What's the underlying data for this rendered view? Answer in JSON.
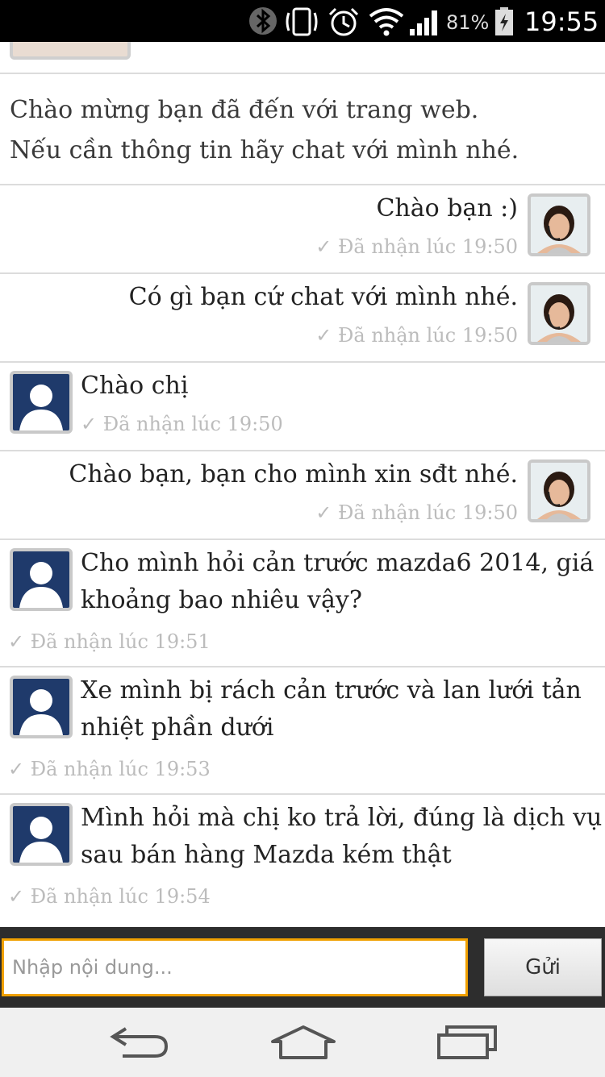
{
  "status_bar": {
    "battery_percent": "81%",
    "time": "19:55",
    "icons": [
      "bluetooth-icon",
      "vibrate-icon",
      "alarm-icon",
      "wifi-icon",
      "signal-icon",
      "battery-charging-icon"
    ]
  },
  "welcome": {
    "line1": "Chào mừng bạn đã đến với trang web.",
    "line2": "Nếu cần thông tin hãy chat với mình nhé."
  },
  "messages": [
    {
      "sender": "agent",
      "text_lines": [
        "Chào bạn :)"
      ],
      "time": "✓ Đã nhận lúc 19:50"
    },
    {
      "sender": "agent",
      "text_lines": [
        "Có gì bạn cứ chat với mình nhé."
      ],
      "time": "✓ Đã nhận lúc 19:50"
    },
    {
      "sender": "user",
      "text_lines": [
        "Chào chị"
      ],
      "time": "✓ Đã nhận lúc 19:50"
    },
    {
      "sender": "agent",
      "text_lines": [
        "Chào bạn, bạn cho mình xin sđt nhé."
      ],
      "time": "✓ Đã nhận lúc 19:50"
    },
    {
      "sender": "user",
      "text_lines": [
        "Cho mình hỏi cản trước mazda6 2014, giá",
        "khoảng bao nhiêu vậy?"
      ],
      "time": "✓ Đã nhận lúc 19:51"
    },
    {
      "sender": "user",
      "text_lines": [
        "Xe mình bị rách cản trước và lan lưới tản",
        "nhiệt phần dưới"
      ],
      "time": "✓ Đã nhận lúc 19:53"
    },
    {
      "sender": "user",
      "text_lines": [
        "Mình hỏi mà chị ko trả lời, đúng là dịch vụ",
        "sau bán hàng Mazda kém thật"
      ],
      "time": "✓ Đã nhận lúc 19:54"
    }
  ],
  "input": {
    "placeholder": "Nhập nội dung...",
    "send_label": "Gửi",
    "accent_color": "#f0a000"
  },
  "nav_bar": {
    "icons": [
      "back-icon",
      "home-icon",
      "recent-apps-icon"
    ]
  }
}
